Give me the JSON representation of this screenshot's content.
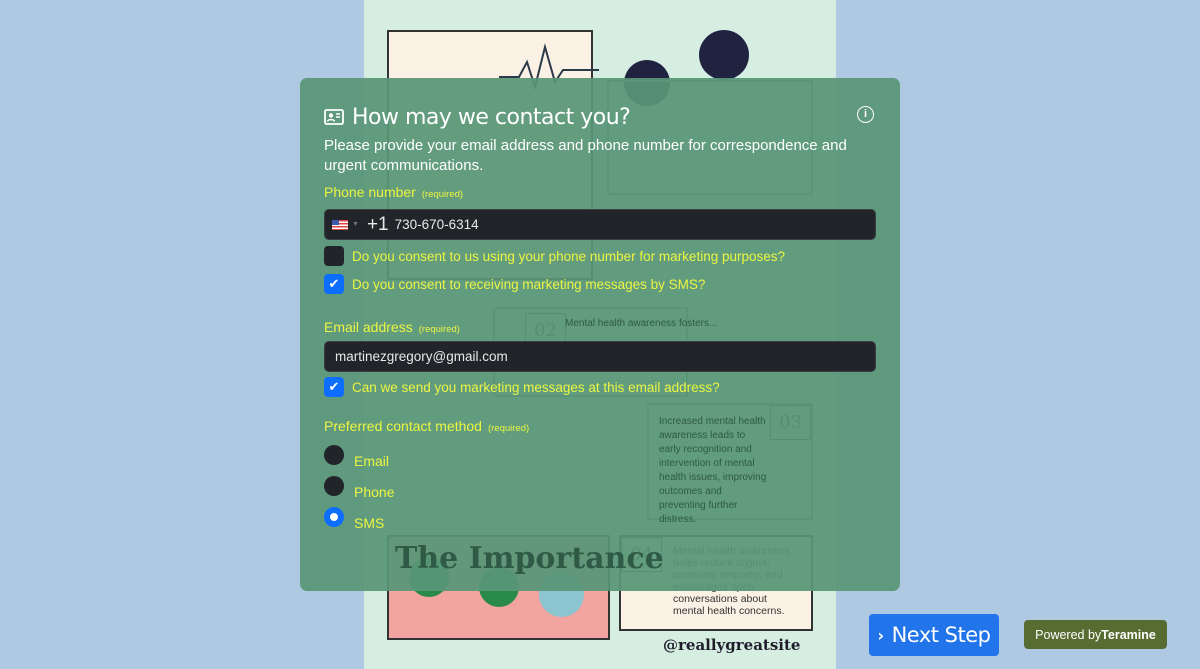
{
  "poster": {
    "title": "The Importance",
    "items": [
      {
        "num": "02",
        "text": "Mental health awareness fosters..."
      },
      {
        "num": "03",
        "text": "Increased mental health awareness leads to early recognition and intervention of mental health issues, improving outcomes and preventing further distress."
      },
      {
        "num": "04",
        "text": "Mental health awareness helps reduce stigma, promotes empathy, and encourages open conversations about mental health concerns."
      }
    ],
    "handle": "@reallygreatsite"
  },
  "modal": {
    "title": "How may we contact you?",
    "title_icon": "contact-card-icon",
    "info_icon": "info-icon",
    "description": "Please provide your email address and phone number for correspondence and urgent communications.",
    "phone": {
      "label": "Phone number",
      "required": "(required)",
      "country_flag": "us-flag",
      "dial_code": "+1",
      "value": "730-670-6314"
    },
    "phone_consents": [
      {
        "label": "Do you consent to us using your phone number for marketing purposes?",
        "checked": false
      },
      {
        "label": "Do you consent to receiving marketing messages by SMS?",
        "checked": true
      }
    ],
    "email": {
      "label": "Email address",
      "required": "(required)",
      "value": "martinezgregory@gmail.com"
    },
    "email_consent": {
      "label": "Can we send you marketing messages at this email address?",
      "checked": true
    },
    "contact_method": {
      "label": "Preferred contact method",
      "required": "(required)",
      "options": [
        "Email",
        "Phone",
        "SMS"
      ],
      "selected": "SMS"
    }
  },
  "footer": {
    "next_label": "Next Step",
    "powered_prefix": "Powered by",
    "powered_brand": "Teramine"
  },
  "colors": {
    "accent": "#0d6efd",
    "label": "#ecf542",
    "next": "#2174ea",
    "powered": "#566c31"
  }
}
